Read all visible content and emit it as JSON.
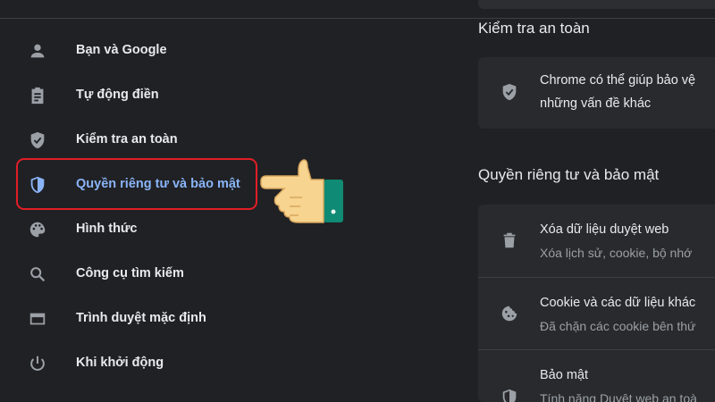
{
  "sidebar": {
    "items": [
      {
        "label": "Bạn và Google",
        "icon": "person-icon"
      },
      {
        "label": "Tự động điền",
        "icon": "clipboard-icon"
      },
      {
        "label": "Kiểm tra an toàn",
        "icon": "shield-check-icon"
      },
      {
        "label": "Quyền riêng tư và bảo mật",
        "icon": "shield-half-icon",
        "active": true
      },
      {
        "label": "Hình thức",
        "icon": "palette-icon"
      },
      {
        "label": "Công cụ tìm kiếm",
        "icon": "search-icon"
      },
      {
        "label": "Trình duyệt mặc định",
        "icon": "browser-window-icon"
      },
      {
        "label": "Khi khởi động",
        "icon": "power-icon"
      }
    ]
  },
  "main": {
    "safety_check": {
      "title": "Kiểm tra an toàn",
      "line1": "Chrome có thể giúp bảo vệ",
      "line2": "những vấn đề khác"
    },
    "privacy": {
      "title": "Quyền riêng tư và bảo mật",
      "rows": [
        {
          "title": "Xóa dữ liệu duyệt web",
          "subtitle": "Xóa lịch sử, cookie, bộ nhớ",
          "icon": "trash-icon"
        },
        {
          "title": "Cookie và các dữ liệu khác",
          "subtitle": "Đã chặn các cookie bên thứ",
          "icon": "cookie-icon"
        },
        {
          "title": "Bảo mật",
          "subtitle": "Tính năng Duyệt web an toà",
          "icon": "shield-half-icon"
        }
      ]
    }
  },
  "colors": {
    "background": "#202124",
    "card": "#292a2d",
    "accent": "#8ab4f8",
    "highlight": "#e21e26",
    "hand_skin": "#f7d48f",
    "hand_sleeve": "#0f8a74"
  }
}
